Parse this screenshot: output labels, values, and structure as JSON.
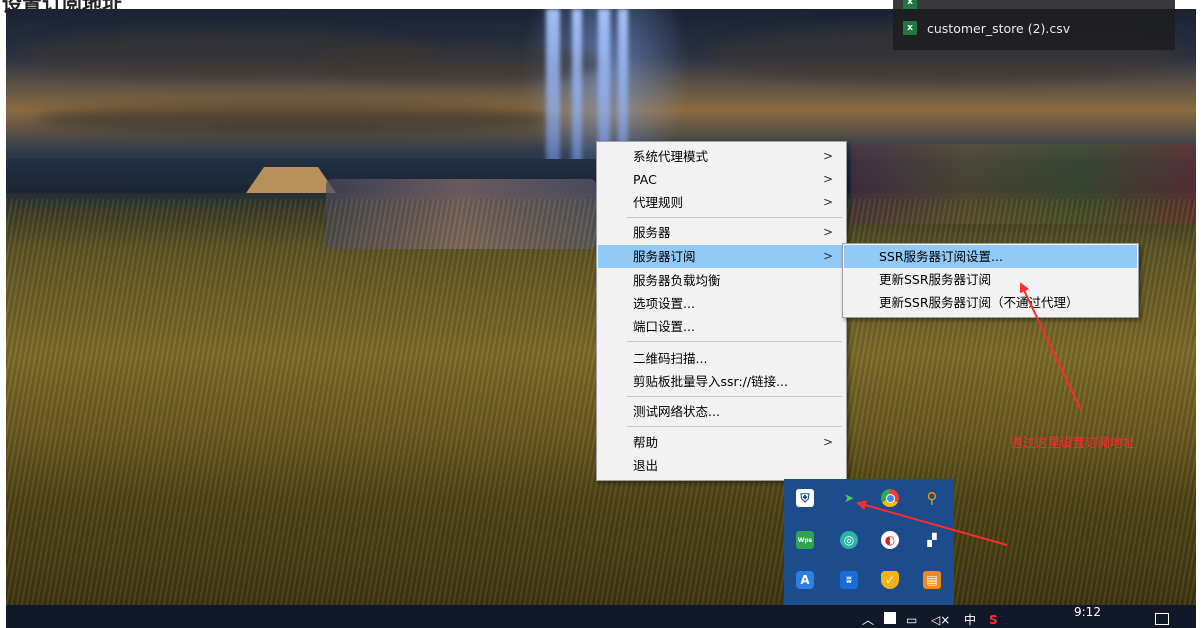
{
  "heading": {
    "text": "设置订阅地址"
  },
  "file_panel": {
    "items": [
      {
        "name": "",
        "icon": "excel-file-icon"
      },
      {
        "name": "customer_store (2).csv",
        "icon": "excel-file-icon"
      }
    ]
  },
  "context_menu": {
    "items": [
      {
        "label": "系统代理模式",
        "submenu": true
      },
      {
        "label": "PAC",
        "submenu": true
      },
      {
        "label": "代理规则",
        "submenu": true
      },
      {
        "label": "服务器",
        "submenu": true
      },
      {
        "label": "服务器订阅",
        "submenu": true,
        "active": true
      },
      {
        "label": "服务器负载均衡",
        "submenu": false
      },
      {
        "label": "选项设置...",
        "submenu": false
      },
      {
        "label": "端口设置...",
        "submenu": false
      },
      {
        "label": "二维码扫描...",
        "submenu": false
      },
      {
        "label": "剪贴板批量导入ssr://链接...",
        "submenu": false
      },
      {
        "label": "测试网络状态...",
        "submenu": false
      },
      {
        "label": "帮助",
        "submenu": true
      },
      {
        "label": "退出",
        "submenu": false
      }
    ],
    "arrow": ">"
  },
  "submenu": {
    "items": [
      {
        "label": "SSR服务器订阅设置...",
        "active": true
      },
      {
        "label": "更新SSR服务器订阅"
      },
      {
        "label": "更新SSR服务器订阅（不通过代理）"
      }
    ]
  },
  "annotation": {
    "text": "通过这里设置订阅地址",
    "color": "#ff2a2a"
  },
  "tray_flyout": {
    "icons": [
      "windows-security-icon",
      "shadowsocksr-icon",
      "chrome-icon",
      "search-icon",
      "wps-office-icon",
      "360-browser-icon",
      "netease-music-icon",
      "bookmark-icon",
      "a-shield-icon",
      "bluetooth-icon",
      "shield-icon",
      "calendar-icon"
    ]
  },
  "taskbar": {
    "time": "9:12",
    "ime": "中",
    "icons": [
      "chevron-up-icon",
      "app-tray-icon",
      "network-icon",
      "volume-icon",
      "ime-icon",
      "sogou-icon",
      "notification-icon"
    ]
  }
}
